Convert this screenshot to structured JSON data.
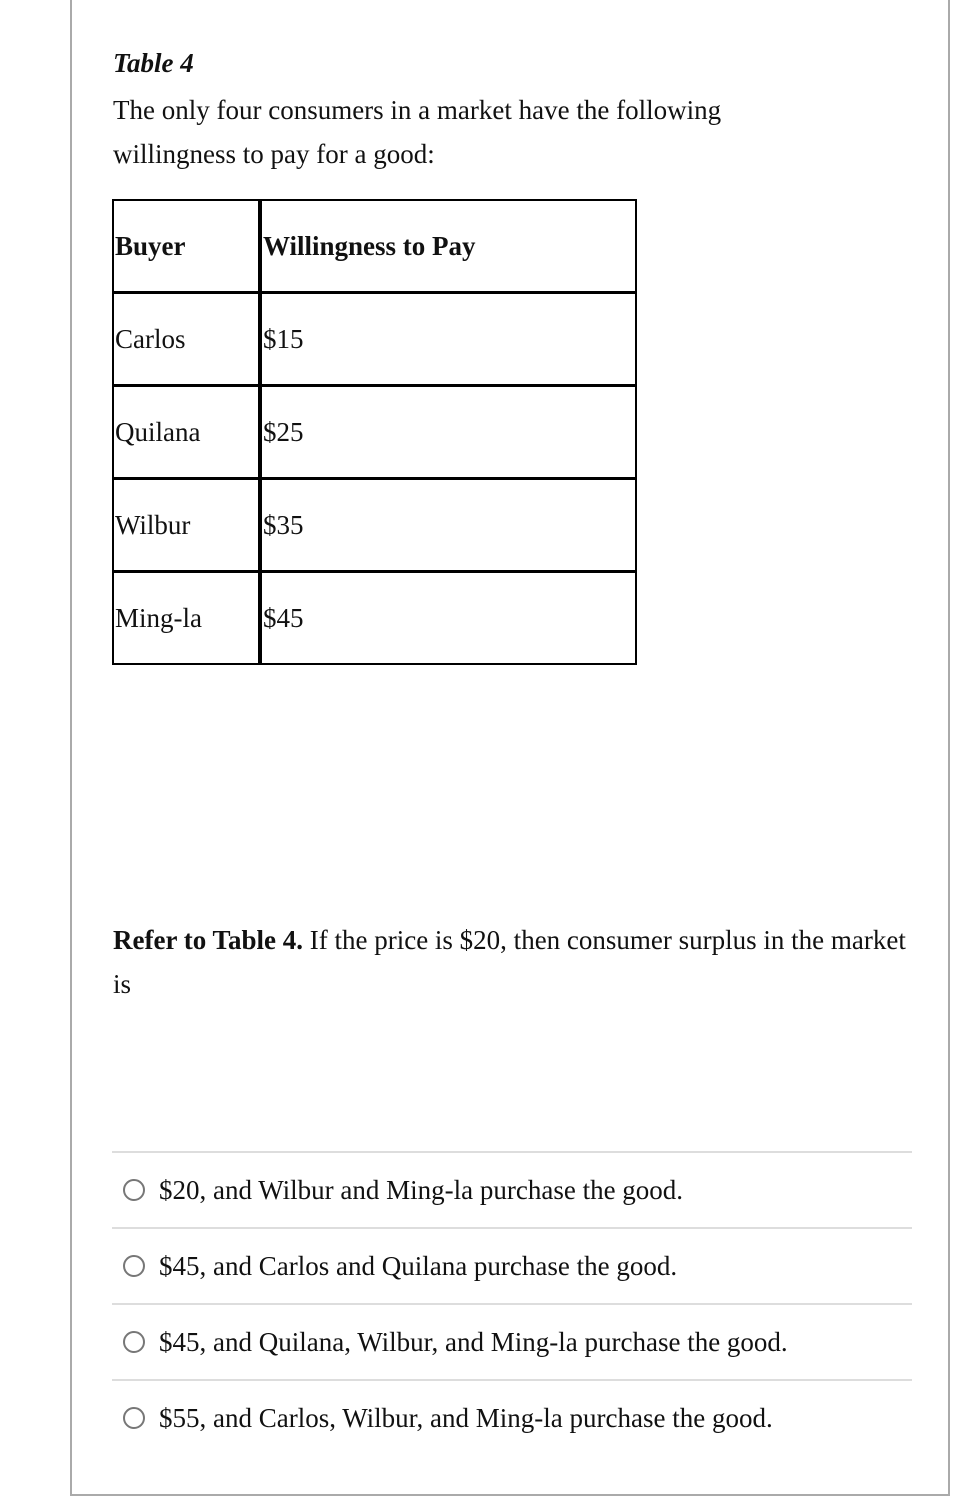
{
  "table_title": "Table 4",
  "intro": "The only four consumers in a market have the following willingness to pay for a good:",
  "table": {
    "headers": [
      "Buyer",
      "Willingness to Pay"
    ],
    "rows": [
      [
        "Carlos",
        "$15"
      ],
      [
        "Quilana",
        "$25"
      ],
      [
        "Wilbur",
        "$35"
      ],
      [
        "Ming-la",
        "$45"
      ]
    ]
  },
  "question": {
    "bold_prefix": "Refer to Table 4.",
    "text": " If the price is $20, then consumer surplus in the market is"
  },
  "options": [
    {
      "label": "$20, and Wilbur and Ming-la purchase the good.",
      "selected": false
    },
    {
      "label": "$45, and Carlos and Quilana purchase the good.",
      "selected": false
    },
    {
      "label": "$45, and Quilana, Wilbur, and Ming-la purchase the good.",
      "selected": false
    },
    {
      "label": "$55, and Carlos, Wilbur, and Ming-la purchase the good.",
      "selected": false
    }
  ]
}
